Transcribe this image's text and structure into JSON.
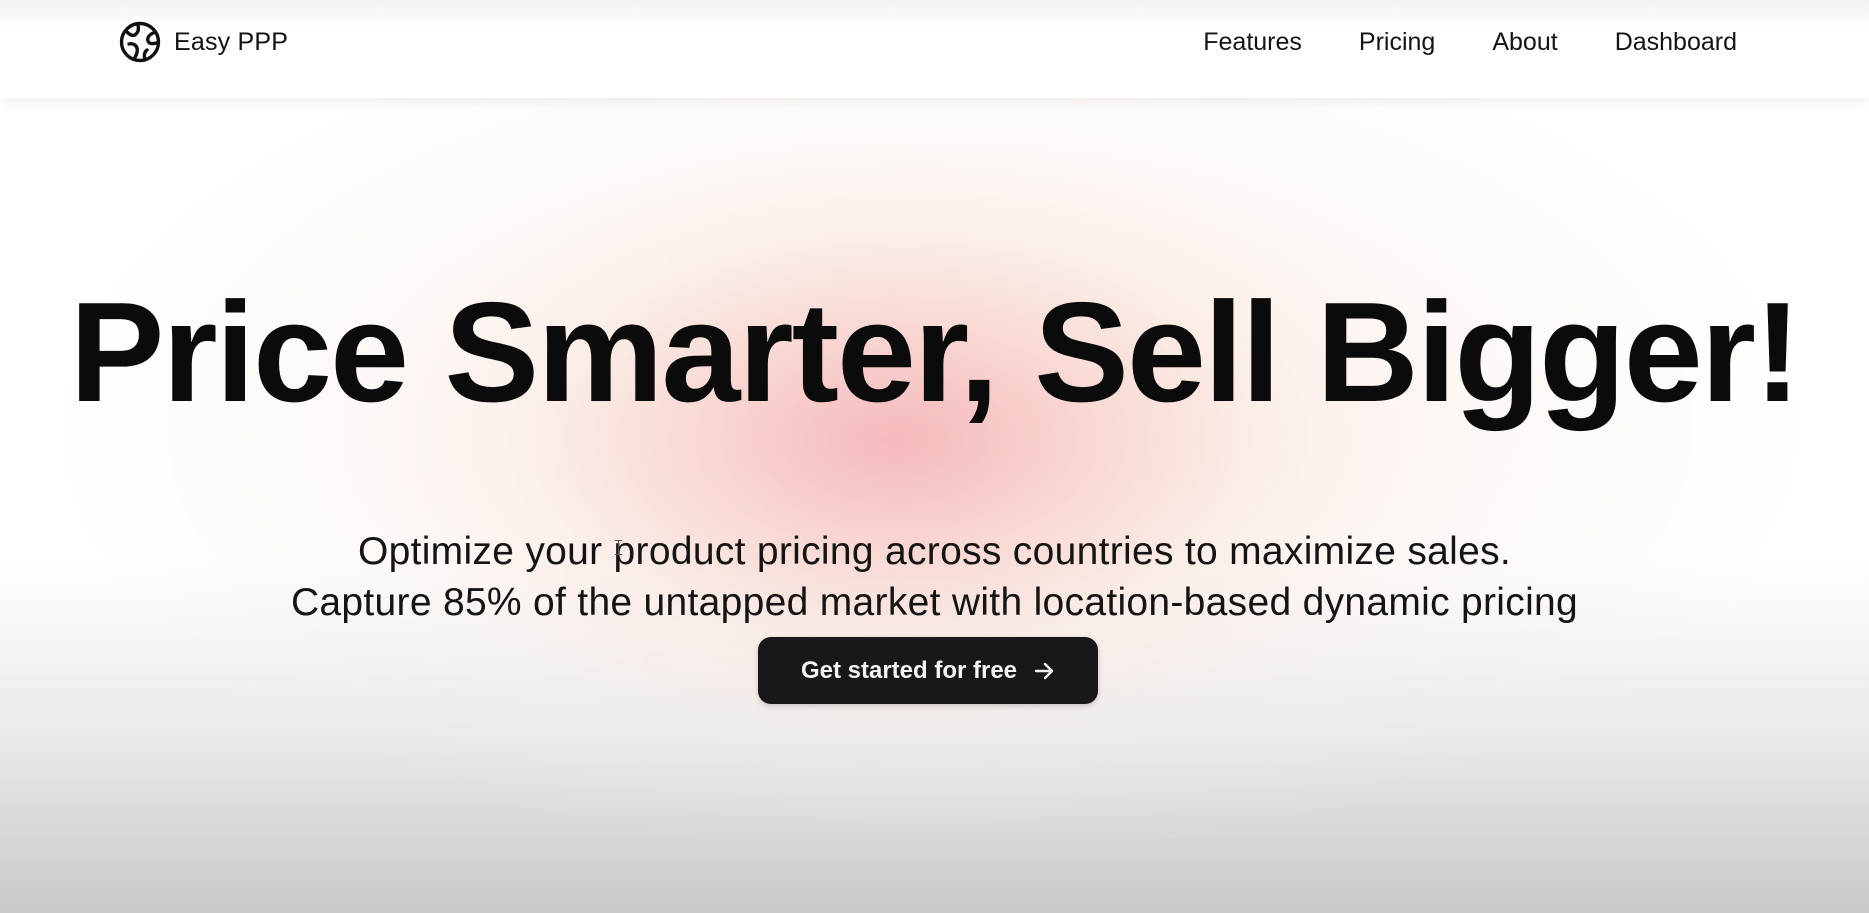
{
  "header": {
    "brand_name": "Easy PPP",
    "brand_icon": "globe-logo-icon",
    "nav": [
      {
        "label": "Features"
      },
      {
        "label": "Pricing"
      },
      {
        "label": "About"
      },
      {
        "label": "Dashboard"
      }
    ]
  },
  "hero": {
    "title": "Price Smarter, Sell Bigger!",
    "subtitle_lines": [
      "Optimize your product pricing across countries to maximize sales.",
      "Capture 85% of the untapped market with location-based dynamic pricing"
    ],
    "cta_label": "Get started for free",
    "cta_icon": "arrow-right-icon"
  },
  "colors": {
    "cta_background": "#18181a",
    "cta_text": "#f4f4f4",
    "glow_pink": "#f4b0b6",
    "text": "#0b0b0c"
  }
}
